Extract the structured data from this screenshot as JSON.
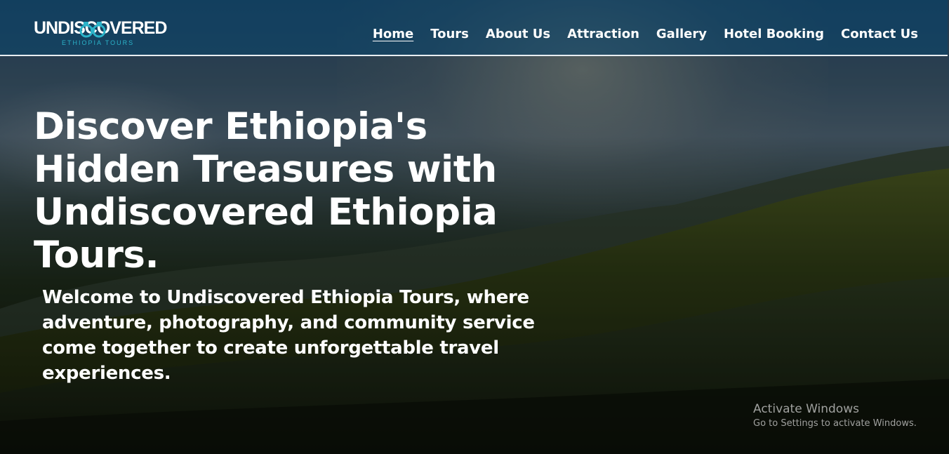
{
  "logo": {
    "main": "UNDISCOVERED",
    "sub": "ETHIOPIA TOURS"
  },
  "nav": {
    "items": [
      {
        "label": "Home",
        "active": true
      },
      {
        "label": "Tours",
        "active": false
      },
      {
        "label": "About Us",
        "active": false
      },
      {
        "label": "Attraction",
        "active": false
      },
      {
        "label": "Gallery",
        "active": false
      },
      {
        "label": "Hotel Booking",
        "active": false
      },
      {
        "label": "Contact Us",
        "active": false
      }
    ]
  },
  "hero": {
    "headline": "Discover Ethiopia's Hidden Treasures with Undiscovered Ethiopia Tours.",
    "welcome": "Welcome to Undiscovered Ethiopia Tours, where adventure, photography, and community service come together to create unforgettable travel experiences."
  },
  "watermark": {
    "title": "Activate Windows",
    "subtitle": "Go to Settings to activate Windows."
  },
  "colors": {
    "navbar": "#084670",
    "logo_accent": "#2bb3c9",
    "text": "#ffffff"
  }
}
